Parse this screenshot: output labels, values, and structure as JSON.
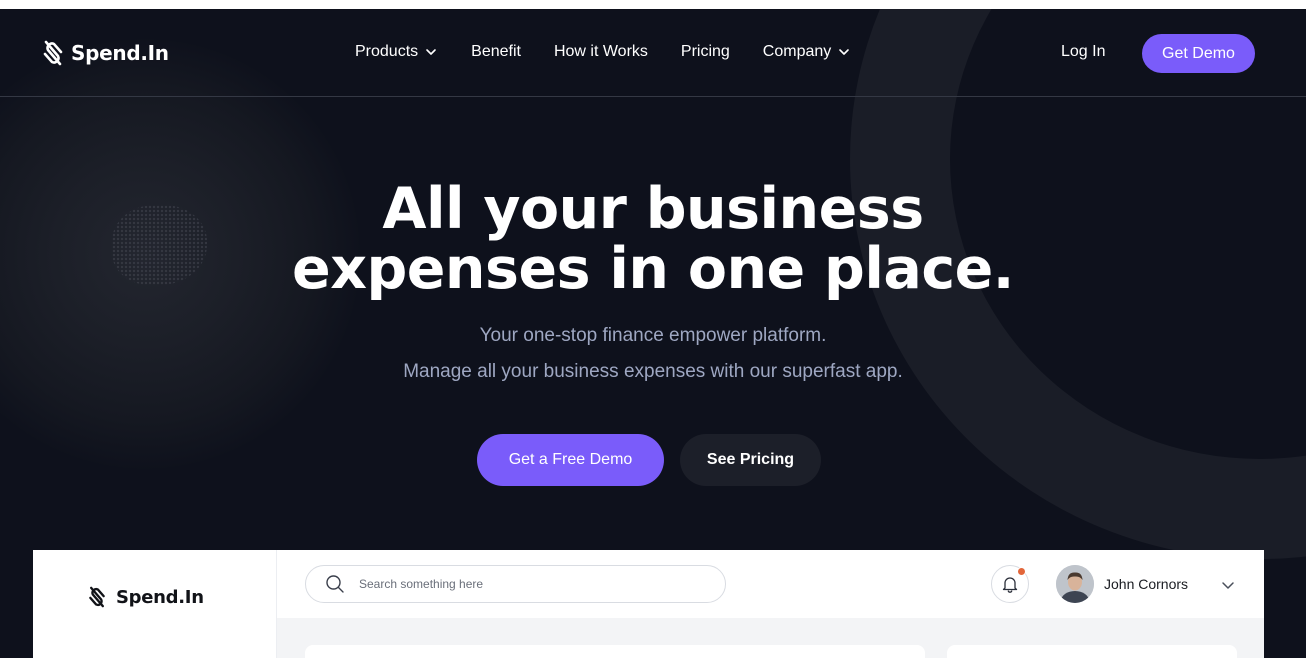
{
  "brand": {
    "name": "Spend.In",
    "accent": "#7a5cfa",
    "background": "#0e111c"
  },
  "nav": {
    "items": [
      {
        "label": "Products",
        "has_dropdown": true
      },
      {
        "label": "Benefit",
        "has_dropdown": false
      },
      {
        "label": "How it Works",
        "has_dropdown": false
      },
      {
        "label": "Pricing",
        "has_dropdown": false
      },
      {
        "label": "Company",
        "has_dropdown": true
      }
    ],
    "login_label": "Log In",
    "demo_label": "Get Demo"
  },
  "hero": {
    "title_line1": "All your business",
    "title_line2": "expenses in one place.",
    "subtitle_line1": "Your one-stop finance empower platform.",
    "subtitle_line2": "Manage all your business expenses with our superfast app.",
    "primary_cta": "Get a Free Demo",
    "secondary_cta": "See Pricing"
  },
  "dashboard": {
    "brand": "Spend.In",
    "search": {
      "placeholder": "Search something here",
      "value": ""
    },
    "notification_status_color": "#e2663a",
    "user_name": "John Cornors"
  },
  "icons": [
    "logo-icon",
    "chevron-down-icon",
    "search-icon",
    "bell-icon",
    "avatar"
  ]
}
